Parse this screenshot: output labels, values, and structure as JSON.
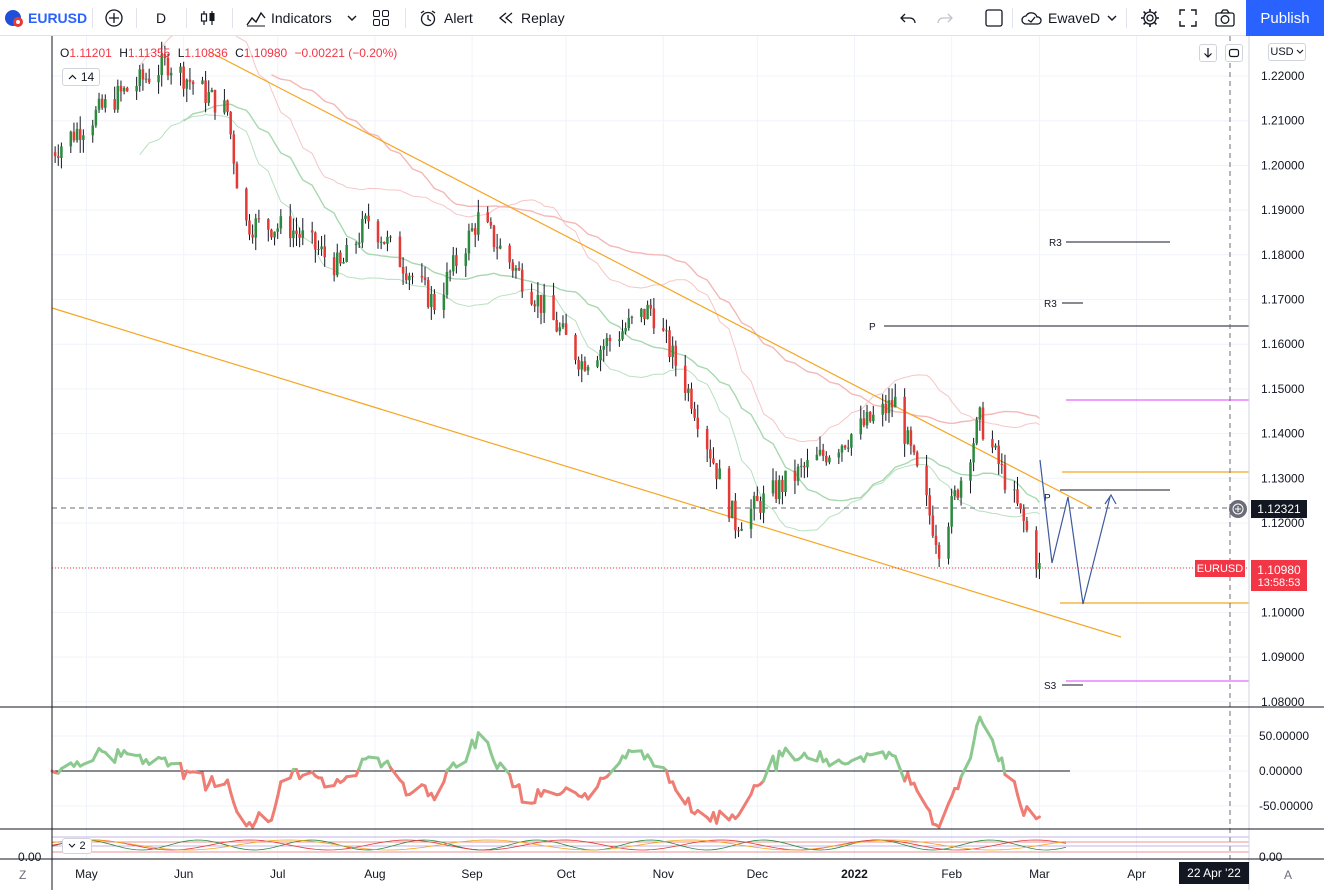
{
  "toolbar": {
    "symbol": "EURUSD",
    "interval": "D",
    "indicators": "Indicators",
    "alert": "Alert",
    "replay": "Replay",
    "layout": "EwaveD",
    "publish": "Publish"
  },
  "legend": {
    "o_label": "O",
    "o": "1.11201",
    "h_label": "H",
    "h": "1.11355",
    "l_label": "L",
    "l": "1.10836",
    "c_label": "C",
    "c": "1.10980",
    "change": "−0.00221 (−0.20%)",
    "bar_count": "14"
  },
  "price_axis": {
    "currency": "USD",
    "ticks": [
      "1.22000",
      "1.21000",
      "1.20000",
      "1.19000",
      "1.18000",
      "1.17000",
      "1.16000",
      "1.15000",
      "1.14000",
      "1.13000",
      "1.12000",
      "1.11000",
      "1.10000",
      "1.09000",
      "1.08000"
    ],
    "crosshair_price": "1.12321",
    "last_symbol": "EURUSD",
    "last_price": "1.10980",
    "countdown": "13:58:53"
  },
  "osc1_axis": {
    "ticks": [
      "50.00000",
      "0.00000",
      "-50.00000"
    ]
  },
  "osc2": {
    "collapse_label": "2",
    "left_value": "0.00",
    "right_value": "0.00"
  },
  "time_axis": {
    "labels": [
      "May",
      "Jun",
      "Jul",
      "Aug",
      "Sep",
      "Oct",
      "Nov",
      "Dec",
      "2022",
      "Feb",
      "Mar",
      "Apr"
    ],
    "crosshair_date": "22 Apr '22",
    "z_label": "Z",
    "a_label": "A"
  },
  "pivots": {
    "r3a": "R3",
    "r3b": "R3",
    "p1": "P",
    "p2": "P",
    "s3": "S3"
  },
  "colors": {
    "up": "#2b8a3e",
    "down": "#e53935",
    "accent": "#2962ff",
    "trend": "#f5a623",
    "pivot": "#131722",
    "pivot_magenta": "#e040fb"
  },
  "chart_data": {
    "type": "candlestick",
    "series_key_points": [
      {
        "date": "2021-04-20",
        "close": 1.203
      },
      {
        "date": "2021-05-10",
        "close": 1.215
      },
      {
        "date": "2021-05-27",
        "close": 1.223
      },
      {
        "date": "2021-06-15",
        "close": 1.212
      },
      {
        "date": "2021-06-20",
        "close": 1.187
      },
      {
        "date": "2021-07-05",
        "close": 1.186
      },
      {
        "date": "2021-07-21",
        "close": 1.177
      },
      {
        "date": "2021-07-30",
        "close": 1.188
      },
      {
        "date": "2021-08-20",
        "close": 1.169
      },
      {
        "date": "2021-09-03",
        "close": 1.188
      },
      {
        "date": "2021-09-22",
        "close": 1.17
      },
      {
        "date": "2021-10-06",
        "close": 1.156
      },
      {
        "date": "2021-10-28",
        "close": 1.168
      },
      {
        "date": "2021-11-10",
        "close": 1.148
      },
      {
        "date": "2021-11-24",
        "close": 1.12
      },
      {
        "date": "2021-12-10",
        "close": 1.129
      },
      {
        "date": "2022-01-14",
        "close": 1.147
      },
      {
        "date": "2022-01-28",
        "close": 1.115
      },
      {
        "date": "2022-02-10",
        "close": 1.143
      },
      {
        "date": "2022-02-24",
        "close": 1.12
      },
      {
        "date": "2022-03-01",
        "close": 1.1098
      }
    ],
    "ylim": [
      1.075,
      1.23
    ],
    "osc1_ylim": [
      -80,
      85
    ],
    "grid": true,
    "legend": "top-left"
  }
}
